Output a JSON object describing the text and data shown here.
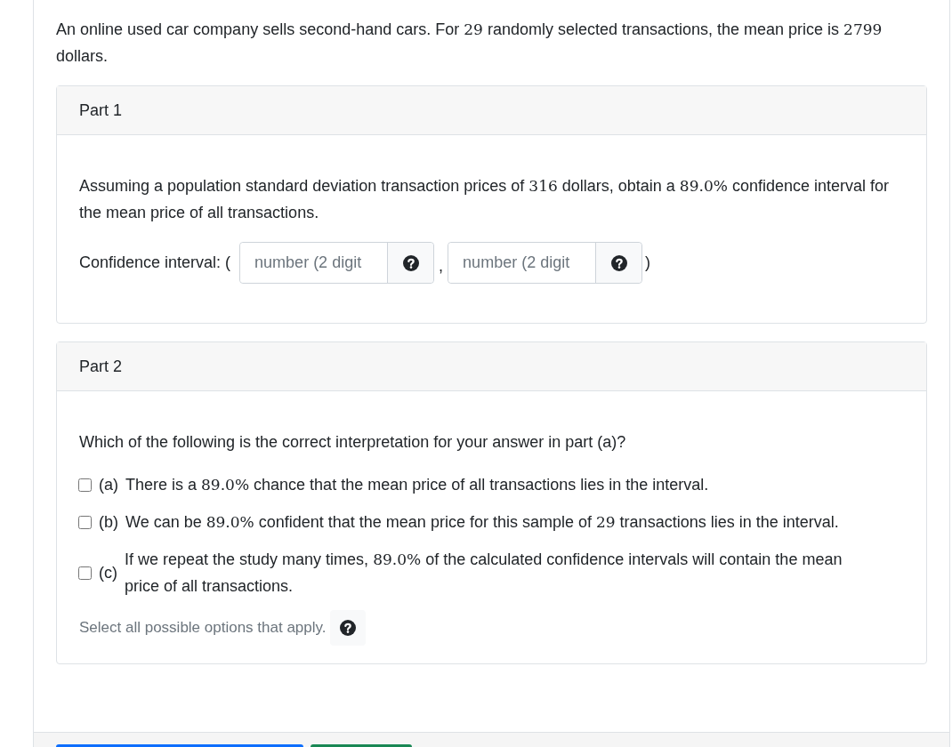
{
  "intro": [
    {
      "text": "An online used car company sells second-hand cars. For ",
      "math": false
    },
    {
      "text": "29",
      "math": true
    },
    {
      "text": " randomly selected transactions, the mean price is ",
      "math": false
    },
    {
      "text": "2799",
      "math": true
    },
    {
      "text": " dollars.",
      "math": false
    }
  ],
  "parts": [
    {
      "title": "Part 1",
      "kind": "interval",
      "question": [
        {
          "text": "Assuming a population standard deviation transaction prices of ",
          "math": false
        },
        {
          "text": "316",
          "math": true
        },
        {
          "text": " dollars, obtain a ",
          "math": false
        },
        {
          "text": "89.0%",
          "math": true
        },
        {
          "text": " confidence interval for the mean price of all transactions.",
          "math": false
        }
      ],
      "label": "Confidence interval: (",
      "separator": ",",
      "close": ")",
      "inputs": [
        {
          "placeholder": "number (2 digit"
        },
        {
          "placeholder": "number (2 digit"
        }
      ]
    },
    {
      "title": "Part 2",
      "kind": "choices",
      "question": [
        {
          "text": "Which of the following is the correct interpretation for your answer in part (a)?",
          "math": false
        }
      ],
      "options": [
        {
          "letter": "(a)",
          "checked": false,
          "text": [
            {
              "text": "There is a ",
              "math": false
            },
            {
              "text": "89.0%",
              "math": true
            },
            {
              "text": " chance that the mean price of all transactions lies in the interval.",
              "math": false
            }
          ]
        },
        {
          "letter": "(b)",
          "checked": false,
          "text": [
            {
              "text": "We can be ",
              "math": false
            },
            {
              "text": "89.0%",
              "math": true
            },
            {
              "text": " confident that the mean price for this sample of ",
              "math": false
            },
            {
              "text": "29",
              "math": true
            },
            {
              "text": " transactions lies in the interval.",
              "math": false
            }
          ]
        },
        {
          "letter": "(c)",
          "checked": false,
          "text": [
            {
              "text": "If we repeat the study many times, ",
              "math": false
            },
            {
              "text": "89.0%",
              "math": true
            },
            {
              "text": " of the calculated confidence intervals will contain the mean price of all transactions.",
              "math": false
            }
          ]
        }
      ],
      "hint": "Select all possible options that apply."
    }
  ]
}
